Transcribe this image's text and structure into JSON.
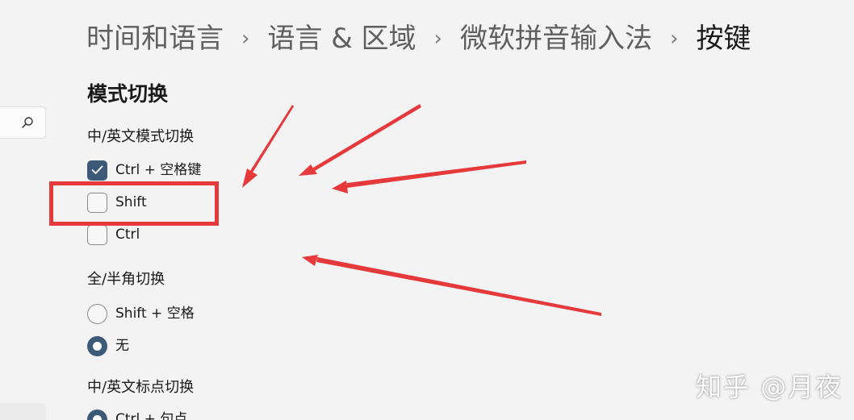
{
  "breadcrumb": {
    "items": [
      "时间和语言",
      "语言 & 区域",
      "微软拼音输入法"
    ],
    "current": "按键",
    "separator": "›"
  },
  "search": {
    "icon": "search-icon"
  },
  "main": {
    "section_title": "模式切换",
    "cn_en_mode": {
      "label": "中/英文模式切换",
      "options": [
        {
          "label": "Ctrl + 空格键",
          "checked": true
        },
        {
          "label": "Shift",
          "checked": false
        },
        {
          "label": "Ctrl",
          "checked": false
        }
      ]
    },
    "full_half_width": {
      "label": "全/半角切换",
      "options": [
        {
          "label": "Shift + 空格",
          "selected": false
        },
        {
          "label": "无",
          "selected": true
        }
      ]
    },
    "punct_mode": {
      "label": "中/英文标点切换",
      "options": [
        {
          "label": "Ctrl + 句点",
          "selected": true
        }
      ]
    }
  },
  "watermark": "知乎 @月夜",
  "colors": {
    "accent": "#3c5a77",
    "annotation_red": "#e6393c",
    "background": "#f3f3f3"
  }
}
